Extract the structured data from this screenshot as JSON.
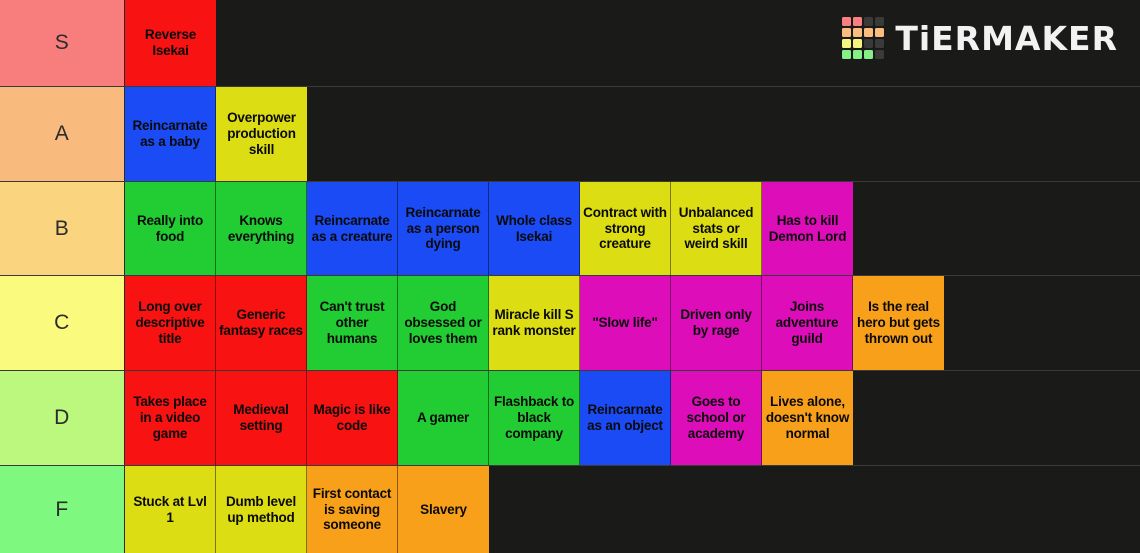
{
  "app": {
    "title": "TierMaker Tier List",
    "background_color": "#1a1a18"
  },
  "logo": {
    "text": "TiERMAKER",
    "grid_colors": [
      "#f98080",
      "#f98080",
      "#3a3a38",
      "#3a3a38",
      "#f9bd80",
      "#f9bd80",
      "#f9bd80",
      "#f9bd80",
      "#f5f580",
      "#f5f580",
      "#3a3a38",
      "#3a3a38",
      "#86f086",
      "#86f086",
      "#86f086",
      "#3a3a38"
    ]
  },
  "palette": {
    "red": "#f81212",
    "blue": "#1b4bf5",
    "yellow": "#dddd14",
    "green": "#22cc33",
    "magenta": "#de0dba",
    "orange": "#f9a01b"
  },
  "tiers": [
    {
      "label": "S",
      "label_color": "#f87e7e",
      "items": [
        {
          "text": "Reverse Isekai",
          "color": "#f81212"
        }
      ]
    },
    {
      "label": "A",
      "label_color": "#f9ba7e",
      "items": [
        {
          "text": "Reincarnate as a baby",
          "color": "#1b4bf5"
        },
        {
          "text": "Overpower production skill",
          "color": "#dddd14"
        }
      ]
    },
    {
      "label": "B",
      "label_color": "#fad47e",
      "items": [
        {
          "text": "Really into food",
          "color": "#22cc33"
        },
        {
          "text": "Knows everything",
          "color": "#22cc33"
        },
        {
          "text": "Reincarnate as a creature",
          "color": "#1b4bf5"
        },
        {
          "text": "Reincarnate as a person dying",
          "color": "#1b4bf5"
        },
        {
          "text": "Whole class Isekai",
          "color": "#1b4bf5"
        },
        {
          "text": "Contract with strong creature",
          "color": "#dddd14"
        },
        {
          "text": "Unbalanced stats or weird skill",
          "color": "#dddd14"
        },
        {
          "text": "Has to kill Demon Lord",
          "color": "#de0dba"
        }
      ]
    },
    {
      "label": "C",
      "label_color": "#fafa7e",
      "items": [
        {
          "text": "Long over descriptive title",
          "color": "#f81212"
        },
        {
          "text": "Generic fantasy races",
          "color": "#f81212"
        },
        {
          "text": "Can't trust other humans",
          "color": "#22cc33"
        },
        {
          "text": "God obsessed or loves them",
          "color": "#22cc33"
        },
        {
          "text": "Miracle kill S rank monster",
          "color": "#dddd14"
        },
        {
          "text": "\"Slow life\"",
          "color": "#de0dba"
        },
        {
          "text": "Driven only by rage",
          "color": "#de0dba"
        },
        {
          "text": "Joins adventure guild",
          "color": "#de0dba"
        },
        {
          "text": "Is the real hero but gets thrown out",
          "color": "#f9a01b"
        }
      ]
    },
    {
      "label": "D",
      "label_color": "#bdf87e",
      "items": [
        {
          "text": "Takes place in a video game",
          "color": "#f81212"
        },
        {
          "text": "Medieval setting",
          "color": "#f81212"
        },
        {
          "text": "Magic is like code",
          "color": "#f81212"
        },
        {
          "text": "A gamer",
          "color": "#22cc33"
        },
        {
          "text": "Flashback to black company",
          "color": "#22cc33"
        },
        {
          "text": "Reincarnate as an object",
          "color": "#1b4bf5"
        },
        {
          "text": "Goes to school or academy",
          "color": "#de0dba"
        },
        {
          "text": "Lives alone, doesn't know normal",
          "color": "#f9a01b"
        }
      ]
    },
    {
      "label": "F",
      "label_color": "#7ef87e",
      "items": [
        {
          "text": "Stuck at Lvl 1",
          "color": "#dddd14"
        },
        {
          "text": "Dumb level up method",
          "color": "#dddd14"
        },
        {
          "text": "First contact is saving someone",
          "color": "#f9a01b"
        },
        {
          "text": "Slavery",
          "color": "#f9a01b"
        }
      ]
    }
  ]
}
